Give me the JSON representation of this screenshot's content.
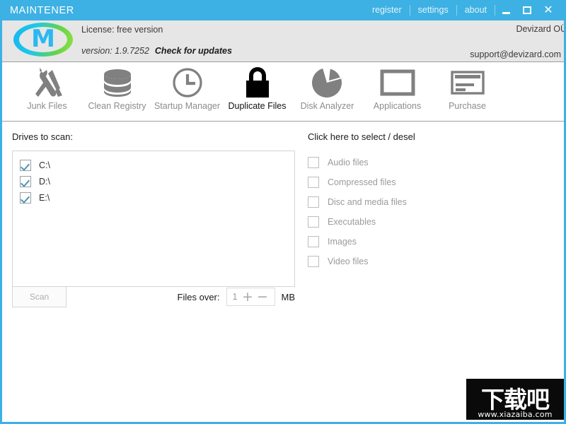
{
  "titlebar": {
    "app_title": "MAINTENER",
    "accent_color": "#3db1e3",
    "links": [
      {
        "label": "register"
      },
      {
        "label": "settings"
      },
      {
        "label": "about"
      }
    ],
    "window_buttons": {
      "minimize": "minimize-icon",
      "maximize": "maximize-icon",
      "close": "✕"
    }
  },
  "header": {
    "logo_letter": "M",
    "license_text": "License: free version",
    "version_text": "version: 1.9.7252",
    "check_update_label": "Check for updates",
    "company": "Devizard OÜ",
    "support_email": "support@devizard.com"
  },
  "toolbar": {
    "items": [
      {
        "label": "Junk Files",
        "icon": "tools-icon",
        "active": false
      },
      {
        "label": "Clean Registry",
        "icon": "database-icon",
        "active": false
      },
      {
        "label": "Startup Manager",
        "icon": "clock-icon",
        "active": false
      },
      {
        "label": "Duplicate Files",
        "icon": "lock-icon",
        "active": true
      },
      {
        "label": "Disk Analyzer",
        "icon": "pie-chart-icon",
        "active": false
      },
      {
        "label": "Applications",
        "icon": "window-icon",
        "active": false
      },
      {
        "label": "Purchase",
        "icon": "credit-card-icon",
        "active": false
      }
    ]
  },
  "main": {
    "drives_label": "Drives to scan:",
    "drives": [
      {
        "label": "C:\\",
        "checked": true
      },
      {
        "label": "D:\\",
        "checked": true
      },
      {
        "label": "E:\\",
        "checked": true
      }
    ],
    "filetypes_label": "Click here to select / deselect all",
    "filetypes": [
      {
        "label": "Audio files",
        "checked": false
      },
      {
        "label": "Compressed files",
        "checked": false
      },
      {
        "label": "Disc and media files",
        "checked": false
      },
      {
        "label": "Executables",
        "checked": false
      },
      {
        "label": "Images",
        "checked": false
      },
      {
        "label": "Video files",
        "checked": false
      }
    ],
    "scan_button": "Scan",
    "files_over_label": "Files over:",
    "files_over_value": "1",
    "stepper_plus": "+",
    "stepper_minus": "−",
    "unit_label": "MB"
  },
  "watermark": {
    "text_cn": "下载吧",
    "url": "www.xiazaiba.com"
  }
}
